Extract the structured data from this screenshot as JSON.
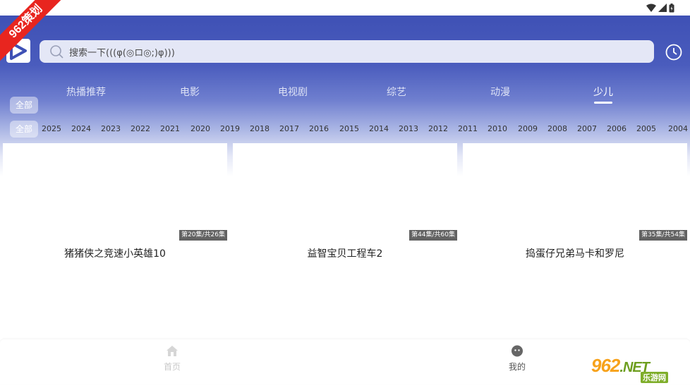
{
  "branding": {
    "ribbon_text": "962策划",
    "watermark_main": "962",
    "watermark_net": ".NET",
    "watermark_sub": "乐游网"
  },
  "search": {
    "placeholder": "搜索一下(((φ(◎ロ◎;)φ)))"
  },
  "tabs": [
    {
      "label": "热播推荐"
    },
    {
      "label": "电影"
    },
    {
      "label": "电视剧"
    },
    {
      "label": "综艺"
    },
    {
      "label": "动漫"
    },
    {
      "label": "少儿"
    }
  ],
  "active_tab": "少儿",
  "filters": {
    "all_label": "全部",
    "year_all_label": "全部",
    "years": [
      "2025",
      "2024",
      "2023",
      "2022",
      "2021",
      "2020",
      "2019",
      "2018",
      "2017",
      "2016",
      "2015",
      "2014",
      "2013",
      "2012",
      "2011",
      "2010",
      "2009",
      "2008",
      "2007",
      "2006",
      "2005",
      "2004"
    ]
  },
  "cards": [
    {
      "title": "猪猪侠之竞速小英雄10",
      "episode": "第20集/共26集"
    },
    {
      "title": "益智宝贝工程车2",
      "episode": "第44集/共60集"
    },
    {
      "title": "捣蛋仔兄弟马卡和罗尼",
      "episode": "第35集/共54集"
    }
  ],
  "bottom_nav": {
    "home_label": "首页",
    "me_label": "我的"
  },
  "colors": {
    "header_primary": "#3f51b5",
    "ribbon": "#e8251f"
  }
}
